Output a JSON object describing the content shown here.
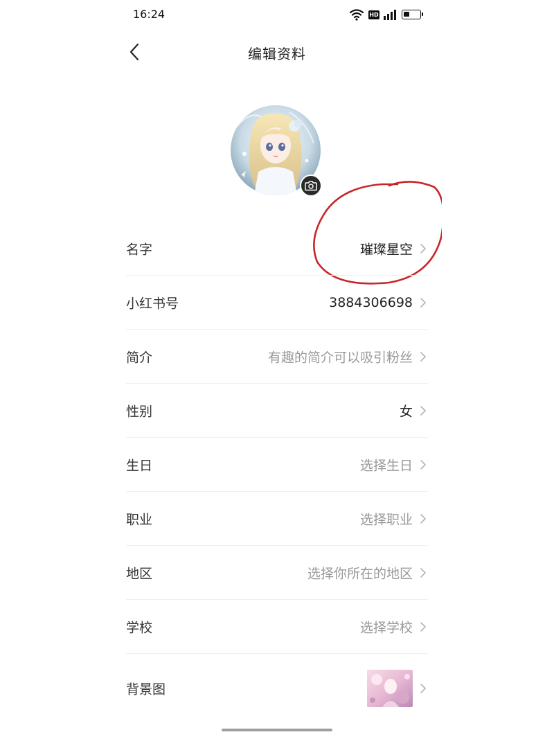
{
  "status_bar": {
    "time": "16:24",
    "icons": [
      "wifi-icon",
      "hd-icon",
      "signal-icon",
      "battery-icon"
    ],
    "battery_level": 0.35
  },
  "header": {
    "title": "编辑资料",
    "back_icon": "chevron-left-icon"
  },
  "avatar": {
    "camera_icon": "camera-icon"
  },
  "fields": [
    {
      "key": "name",
      "label": "名字",
      "value": "璀璨星空",
      "state": "filled"
    },
    {
      "key": "xhs_id",
      "label": "小红书号",
      "value": "3884306698",
      "state": "filled"
    },
    {
      "key": "bio",
      "label": "简介",
      "value": "有趣的简介可以吸引粉丝",
      "state": "placeholder"
    },
    {
      "key": "gender",
      "label": "性别",
      "value": "女",
      "state": "filled"
    },
    {
      "key": "birthday",
      "label": "生日",
      "value": "选择生日",
      "state": "placeholder"
    },
    {
      "key": "occupation",
      "label": "职业",
      "value": "选择职业",
      "state": "placeholder"
    },
    {
      "key": "region",
      "label": "地区",
      "value": "选择你所在的地区",
      "state": "placeholder"
    },
    {
      "key": "school",
      "label": "学校",
      "value": "选择学校",
      "state": "placeholder"
    },
    {
      "key": "background",
      "label": "背景图",
      "value": "",
      "state": "image"
    }
  ],
  "colors": {
    "annotation_red": "#c8262a",
    "placeholder_gray": "#9a9a9a",
    "divider": "#efefef"
  }
}
